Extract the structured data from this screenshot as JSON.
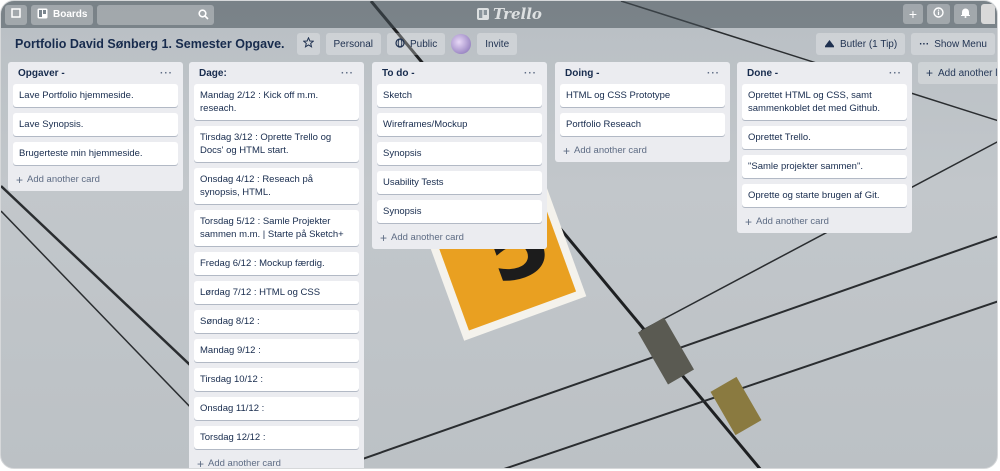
{
  "topbar": {
    "boards_label": "Boards",
    "logo_text": "Trello"
  },
  "board": {
    "title": "Portfolio David Sønberg 1. Semester Opgave.",
    "visibility_label": "Personal",
    "public_label": "Public",
    "invite_label": "Invite",
    "butler_label": "Butler (1 Tip)",
    "show_menu_label": "Show Menu"
  },
  "lists": [
    {
      "title": "Opgaver -",
      "cards": [
        "Lave Portfolio hjemmeside.",
        "Lave Synopsis.",
        "Brugerteste min hjemmeside."
      ],
      "add_label": "Add another card"
    },
    {
      "title": "Dage:",
      "cards": [
        "Mandag 2/12 : Kick off m.m. reseach.",
        "Tirsdag 3/12 : Oprette Trello og Docs' og HTML start.",
        "Onsdag 4/12 : Reseach på synopsis, HTML.",
        "Torsdag 5/12 : Samle Projekter sammen m.m. | Starte på Sketch+",
        "Fredag 6/12 : Mockup færdig.",
        "Lørdag 7/12 : HTML og CSS",
        "Søndag 8/12 :",
        "Mandag 9/12 :",
        "Tirsdag 10/12 :",
        "Onsdag 11/12 :",
        "Torsdag 12/12 :"
      ],
      "add_label": "Add another card"
    },
    {
      "title": "To do -",
      "cards": [
        "Sketch",
        "Wireframes/Mockup",
        "Synopsis",
        "Usability Tests",
        "Synopsis"
      ],
      "add_label": "Add another card"
    },
    {
      "title": "Doing -",
      "cards": [
        "HTML og CSS Prototype",
        "Portfolio Reseach"
      ],
      "add_label": "Add another card"
    },
    {
      "title": "Done -",
      "cards": [
        "Oprettet HTML og CSS, samt sammenkoblet det med Github.",
        "Oprettet Trello.",
        "\"Samle projekter sammen\".",
        "Oprette og starte brugen af Git."
      ],
      "add_label": "Add another card"
    }
  ],
  "add_list_label": "Add another list",
  "icons": {
    "home": "home-icon",
    "boards": "boards-icon",
    "search": "search-icon",
    "add": "plus-icon",
    "info": "info-icon",
    "notifications": "bell-icon",
    "star": "star-icon",
    "globe": "globe-icon",
    "butler": "butler-icon",
    "more": "ellipsis-icon"
  },
  "colors": {
    "list_bg": "#ebecf0",
    "card_bg": "#ffffff",
    "text": "#172b4d",
    "muted": "#5e6c84"
  }
}
